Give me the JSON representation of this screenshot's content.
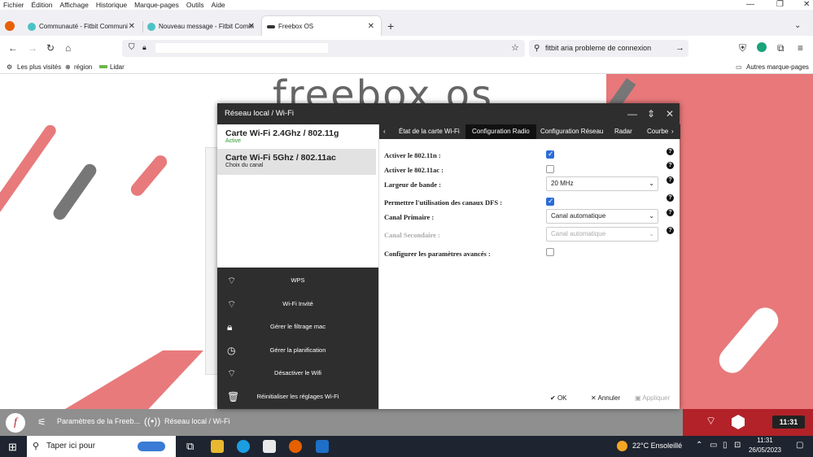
{
  "menu": {
    "items": [
      "Fichier",
      "Édition",
      "Affichage",
      "Historique",
      "Marque-pages",
      "Outils",
      "Aide"
    ]
  },
  "tabs": [
    {
      "label": "Communauté - Fitbit Communi",
      "icon": "fitbit-icon",
      "active": false
    },
    {
      "label": "Nouveau message - Fitbit Comm",
      "icon": "fitbit-icon",
      "active": false
    },
    {
      "label": "Freebox OS",
      "icon": "freebox-icon",
      "active": true
    }
  ],
  "search": {
    "value": "fitbit aria probleme de connexion"
  },
  "bookmarks": {
    "items": [
      "Les plus visités",
      "région",
      "Lidar"
    ],
    "other": "Autres marque-pages"
  },
  "modal": {
    "title": "Réseau local / Wi-Fi",
    "cards": [
      {
        "title": "Carte Wi-Fi 2.4Ghz / 802.11g",
        "subtitle": "Active"
      },
      {
        "title": "Carte Wi-Fi 5Ghz / 802.11ac",
        "subtitle": "Choix du canal"
      }
    ],
    "actions": [
      "WPS",
      "Wi-Fi Invité",
      "Gérer le filtrage mac",
      "Gérer la planification",
      "Désactiver le Wifi",
      "Réinitialiser les réglages Wi-Fi"
    ],
    "subtabs": [
      "État de la carte Wi-Fi",
      "Configuration Radio",
      "Configuration Réseau",
      "Radar",
      "Courbe"
    ],
    "form": {
      "enable_n": "Activer le 802.11n :",
      "enable_ac": "Activer le 802.11ac :",
      "bandwidth": "Largeur de bande :",
      "bandwidth_value": "20 MHz",
      "dfs": "Permettre l'utilisation des canaux DFS :",
      "primary": "Canal Primaire :",
      "primary_value": "Canal automatique",
      "secondary": "Canal Secondaire :",
      "secondary_value": "Canal automatique",
      "advanced": "Configurer les paramètres avancés :"
    },
    "footer": {
      "ok": "OK",
      "cancel": "Annuler",
      "apply": "Appliquer"
    }
  },
  "fbx_taskbar": {
    "item1": "Paramètres de la Freeb...",
    "item2": "Réseau local / Wi-Fi",
    "clock": "11:31"
  },
  "page_bg": {
    "logo": "freebox os"
  },
  "windows": {
    "search_placeholder": "Taper ici pour",
    "weather": "22°C Ensoleillé",
    "time": "11:31",
    "date": "26/05/2023"
  },
  "colors": {
    "accent": "#e8787a",
    "dark": "#2e2e2e",
    "checkbox": "#2b6cd8",
    "freebox_red": "#b22228"
  }
}
